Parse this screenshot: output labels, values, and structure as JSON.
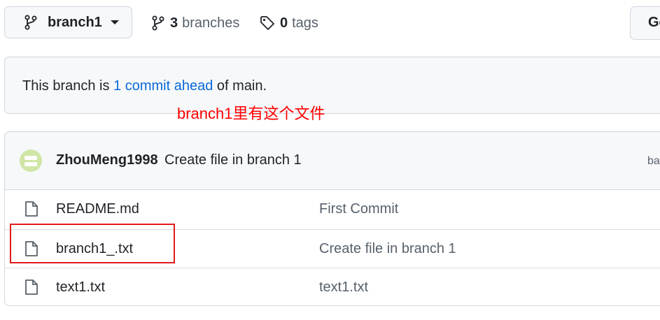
{
  "branch_selector": {
    "label": "branch1",
    "icon": "git-branch-icon"
  },
  "stats": {
    "branches_count": "3",
    "branches_label": "branches",
    "tags_count": "0",
    "tags_label": "tags"
  },
  "goto_button": {
    "label": "Go"
  },
  "ahead_banner": {
    "prefix": "This branch is ",
    "link": "1 commit ahead",
    "suffix": " of main."
  },
  "annotation": {
    "text": "branch1里有这个文件",
    "color": "#ff0000"
  },
  "latest_commit": {
    "author": "ZhouMeng1998",
    "message": "Create file in branch 1",
    "sha_partial": "ba"
  },
  "files": [
    {
      "name": "README.md",
      "commit_message": "First Commit",
      "icon": "file-icon"
    },
    {
      "name": "branch1_.txt",
      "commit_message": "Create file in branch 1",
      "icon": "file-icon"
    },
    {
      "name": "text1.txt",
      "commit_message": "text1.txt",
      "icon": "file-icon"
    }
  ],
  "colors": {
    "link": "#0969da",
    "muted": "#57606a",
    "highlight": "#e01b1b"
  }
}
